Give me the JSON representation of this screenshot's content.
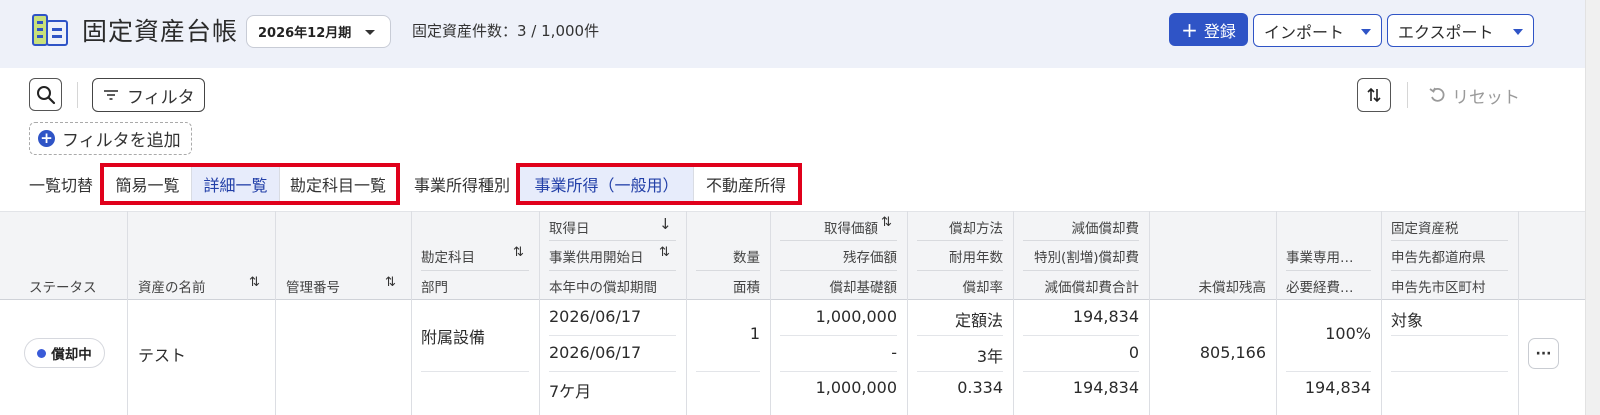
{
  "header": {
    "title": "固定資産台帳",
    "period": "2026年12月期",
    "asset_count": "固定資産件数：3 / 1,000件",
    "register_label": "登録",
    "import_label": "インポート",
    "export_label": "エクスポート",
    "accent_color": "#2f54c6"
  },
  "toolbar": {
    "filter_label": "フィルタ",
    "reset_label": "リセット",
    "add_filter_label": "フィルタを追加"
  },
  "views": {
    "list_switch_label": "一覧切替",
    "list_options": [
      "簡易一覧",
      "詳細一覧",
      "勘定科目一覧"
    ],
    "list_selected": "詳細一覧",
    "income_type_label": "事業所得種別",
    "income_options": [
      "事業所得（一般用）",
      "不動産所得"
    ],
    "income_selected": "事業所得（一般用）"
  },
  "table": {
    "headers": {
      "status": "ステータス",
      "asset_name": "資産の名前",
      "management_no": "管理番号",
      "account": "勘定科目",
      "department": "部門",
      "acquisition_date": "取得日",
      "service_start": "事業供用開始日",
      "period_this_year": "本年中の償却期間",
      "quantity": "数量",
      "area": "面積",
      "acquisition_price": "取得価額",
      "residual_value": "残存価額",
      "depreciation_base": "償却基礎額",
      "method": "償却方法",
      "useful_life": "耐用年数",
      "rate": "償却率",
      "depreciation_expense": "減価償却費",
      "special_depreciation": "特別(割増)償却費",
      "depreciation_total": "減価償却費合計",
      "book_balance": "未償却残高",
      "business_ratio": "事業専用…",
      "necessary_expense": "必要経費…",
      "property_tax": "固定資産税",
      "prefecture": "申告先都道府県",
      "municipality": "申告先市区町村"
    },
    "rows": [
      {
        "status": "償却中",
        "asset_name": "テスト",
        "management_no": "",
        "account": "附属設備",
        "department": "",
        "acquisition_date": "2026/06/17",
        "service_start": "2026/06/17",
        "period_this_year": "7ケ月",
        "quantity": "1",
        "area": "",
        "acquisition_price": "1,000,000",
        "residual_value": "-",
        "depreciation_base": "1,000,000",
        "method": "定額法",
        "useful_life": "3年",
        "rate": "0.334",
        "depreciation_expense": "194,834",
        "special_depreciation": "0",
        "depreciation_total": "194,834",
        "book_balance": "805,166",
        "business_ratio": "100%",
        "necessary_expense": "194,834",
        "property_tax": "対象",
        "more_label": "···"
      }
    ]
  }
}
